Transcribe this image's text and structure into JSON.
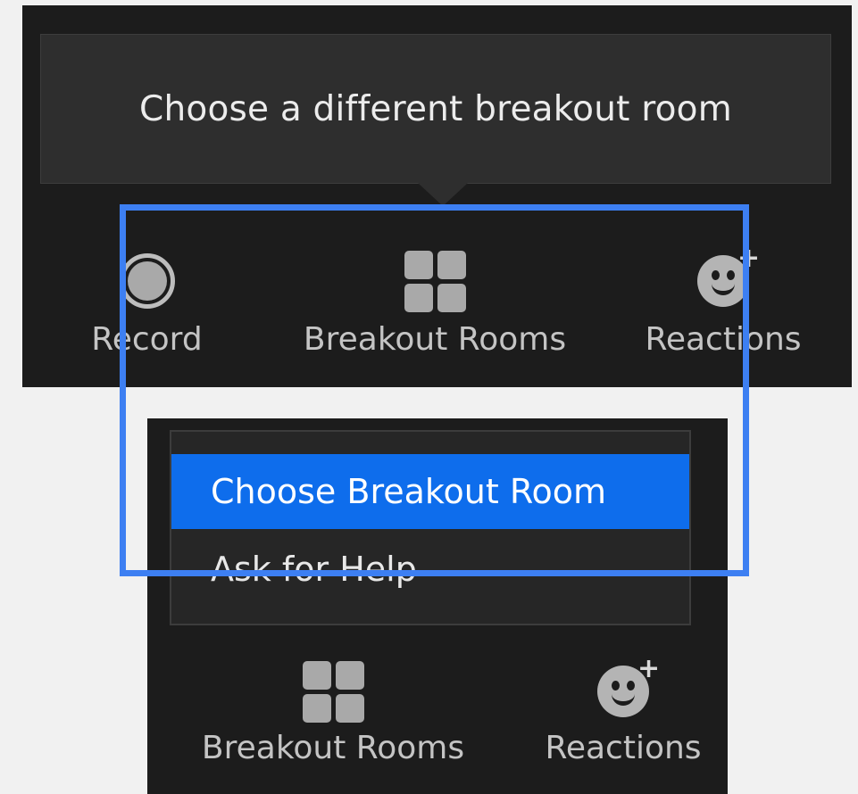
{
  "top_toolbar": {
    "tooltip": "Choose a different breakout room",
    "record_label": "Record",
    "breakout_rooms_label": "Breakout Rooms",
    "reactions_label": "Reactions"
  },
  "dropdown_menu": {
    "items": [
      {
        "label": "Choose Breakout Room",
        "selected": true
      },
      {
        "label": "Ask for Help",
        "selected": false
      }
    ]
  },
  "bottom_toolbar": {
    "breakout_rooms_label": "Breakout Rooms",
    "reactions_label": "Reactions"
  },
  "icons": {
    "record": "record-icon",
    "breakout_rooms": "grid-icon",
    "reactions": "smiley-plus-icon"
  },
  "colors": {
    "toolbar_bg": "#1c1c1c",
    "tooltip_bg": "#2e2e2e",
    "menu_selected": "#0e6dec",
    "highlight_border": "#3d7ff2",
    "page_bg": "#f1f1f1"
  }
}
